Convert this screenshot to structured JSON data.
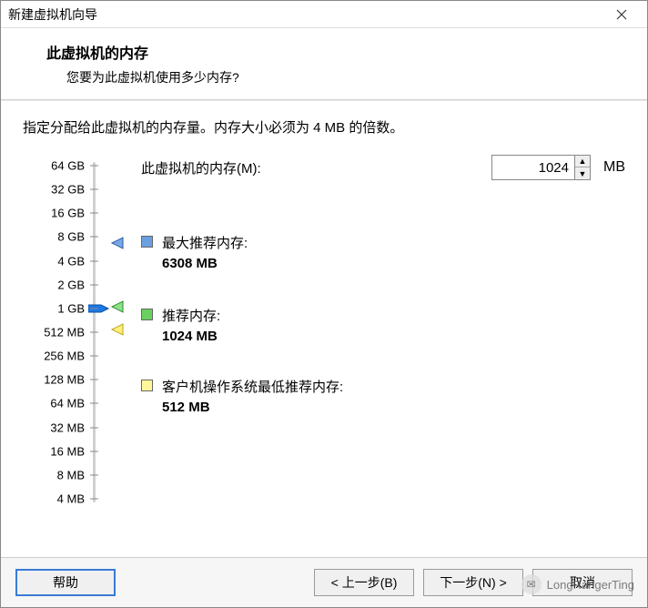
{
  "window": {
    "title": "新建虚拟机向导"
  },
  "header": {
    "title": "此虚拟机的内存",
    "subtitle": "您要为此虚拟机使用多少内存?"
  },
  "instruction": "指定分配给此虚拟机的内存量。内存大小必须为 4 MB 的倍数。",
  "field": {
    "label": "此虚拟机的内存(M):",
    "value": "1024",
    "unit": "MB"
  },
  "scale": {
    "ticks": [
      "64 GB",
      "32 GB",
      "16 GB",
      "8 GB",
      "4 GB",
      "2 GB",
      "1 GB",
      "512 MB",
      "256 MB",
      "128 MB",
      "64 MB",
      "32 MB",
      "16 MB",
      "8 MB",
      "4 MB"
    ]
  },
  "markers": {
    "max": {
      "label": "最大推荐内存:",
      "value": "6308 MB"
    },
    "rec": {
      "label": "推荐内存:",
      "value": "1024 MB"
    },
    "min": {
      "label": "客户机操作系统最低推荐内存:",
      "value": "512 MB"
    }
  },
  "buttons": {
    "help": "帮助",
    "back": "< 上一步(B)",
    "next": "下一步(N) >",
    "cancel": "取消"
  },
  "watermark": "LongRangerTing"
}
